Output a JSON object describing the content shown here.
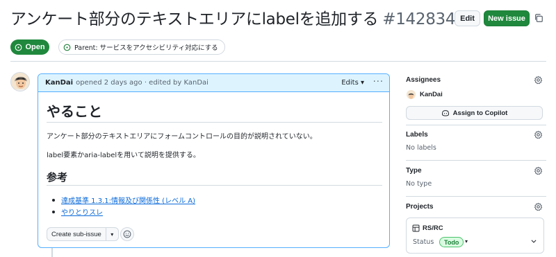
{
  "header": {
    "title": "アンケート部分のテキストエリアにlabelを追加する",
    "number": "#142834",
    "edit_label": "Edit",
    "new_issue_label": "New issue"
  },
  "status": {
    "state_label": "Open",
    "parent_label": "Parent: サービスをアクセシビリティ対応にする"
  },
  "comment": {
    "author": "KanDai",
    "meta": "opened 2 days ago · edited by KanDai",
    "edits_label": "Edits",
    "heading1": "やること",
    "paragraph1": "アンケート部分のテキストエリアにフォームコントロールの目的が説明されていない。",
    "paragraph2": "label要素かaria-labelを用いて説明を提供する。",
    "heading2": "参考",
    "links": [
      "達成基準 1.3.1:情報及び関係性 (レベル A)",
      "やりとりスレ"
    ],
    "create_sub_issue_label": "Create sub-issue"
  },
  "sidebar": {
    "assignees": {
      "label": "Assignees",
      "user": "KanDai",
      "copilot_label": "Assign to Copilot"
    },
    "labels": {
      "label": "Labels",
      "value": "No labels"
    },
    "type": {
      "label": "Type",
      "value": "No type"
    },
    "projects": {
      "label": "Projects",
      "project_name": "RS/RC",
      "status_label": "Status",
      "status_value": "Todo"
    }
  },
  "colors": {
    "open_green": "#1f883d",
    "link_blue": "#0969da",
    "comment_header_bg": "#ddf4ff",
    "comment_border": "#54aeff",
    "todo_bg": "#dafbe1"
  },
  "icons": [
    "issue-open-icon",
    "parent-issue-icon",
    "copy-icon",
    "kebab-icon",
    "smiley-icon",
    "gear-icon",
    "copilot-icon",
    "project-table-icon",
    "chevron-down-icon"
  ]
}
